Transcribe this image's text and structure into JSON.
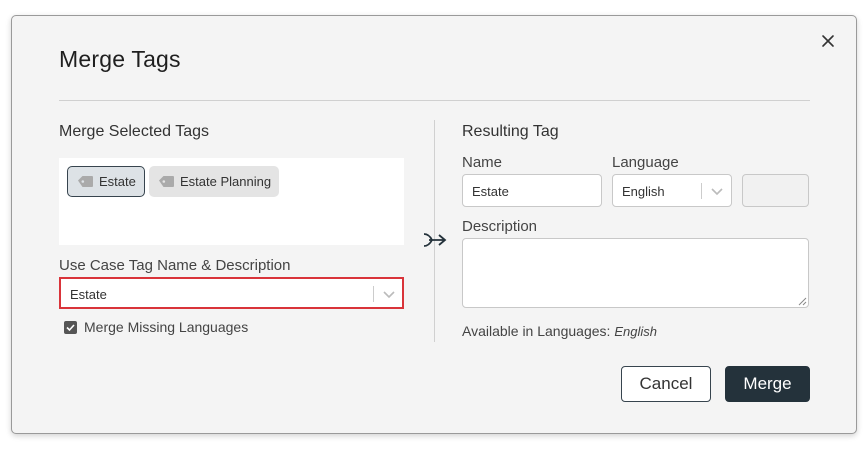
{
  "dialog": {
    "title": "Merge Tags"
  },
  "left": {
    "heading": "Merge Selected Tags",
    "tags": [
      {
        "label": "Estate"
      },
      {
        "label": "Estate Planning"
      }
    ],
    "use_case_label": "Use Case Tag Name & Description",
    "use_case_value": "Estate",
    "merge_missing_label": "Merge Missing Languages",
    "merge_missing_checked": true
  },
  "right": {
    "heading": "Resulting Tag",
    "name_label": "Name",
    "name_value": "Estate",
    "language_label": "Language",
    "language_value": "English",
    "description_label": "Description",
    "description_value": "",
    "available_label": "Available in Languages:",
    "available_value": "English"
  },
  "buttons": {
    "cancel": "Cancel",
    "merge": "Merge"
  },
  "colors": {
    "accent_dark": "#24323b",
    "error_border": "#d9343a"
  }
}
